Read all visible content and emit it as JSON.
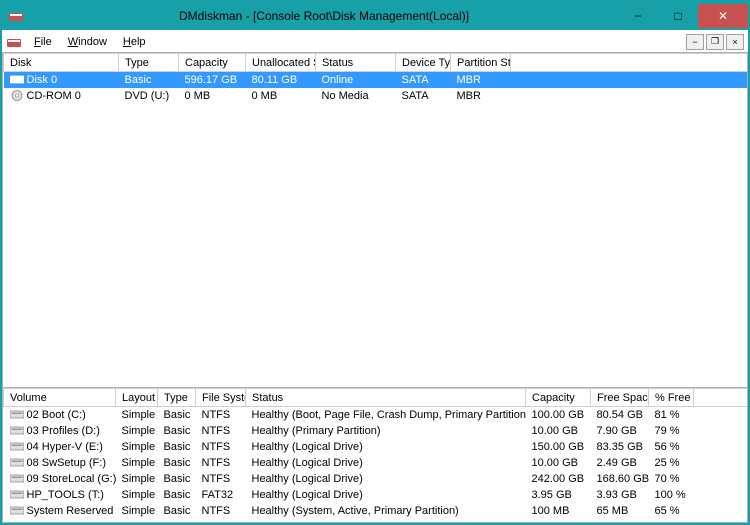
{
  "window": {
    "title": "DMdiskman - [Console Root\\Disk Management(Local)]"
  },
  "menu": {
    "file": "File",
    "window": "Window",
    "help": "Help"
  },
  "top_table": {
    "headers": {
      "disk": "Disk",
      "type": "Type",
      "capacity": "Capacity",
      "unallocated": "Unallocated Sp...",
      "status": "Status",
      "device_type": "Device Type",
      "partition_style": "Partition Style"
    },
    "rows": [
      {
        "disk": "Disk 0",
        "type": "Basic",
        "capacity": "596.17 GB",
        "unallocated": "80.11 GB",
        "status": "Online",
        "device_type": "SATA",
        "partition_style": "MBR",
        "selected": true,
        "icon": "hdd"
      },
      {
        "disk": "CD-ROM 0",
        "type": "DVD (U:)",
        "capacity": "0 MB",
        "unallocated": "0 MB",
        "status": "No Media",
        "device_type": "SATA",
        "partition_style": "MBR",
        "selected": false,
        "icon": "cd"
      }
    ]
  },
  "bottom_table": {
    "headers": {
      "volume": "Volume",
      "layout": "Layout",
      "type": "Type",
      "fs": "File System",
      "status": "Status",
      "capacity": "Capacity",
      "free": "Free Space",
      "pct": "% Free"
    },
    "rows": [
      {
        "volume": "02 Boot (C:)",
        "layout": "Simple",
        "type": "Basic",
        "fs": "NTFS",
        "status": "Healthy (Boot, Page File, Crash Dump, Primary Partition)",
        "capacity": "100.00 GB",
        "free": "80.54 GB",
        "pct": "81 %"
      },
      {
        "volume": "03 Profiles (D:)",
        "layout": "Simple",
        "type": "Basic",
        "fs": "NTFS",
        "status": "Healthy (Primary Partition)",
        "capacity": "10.00 GB",
        "free": "7.90 GB",
        "pct": "79 %"
      },
      {
        "volume": "04 Hyper-V (E:)",
        "layout": "Simple",
        "type": "Basic",
        "fs": "NTFS",
        "status": "Healthy (Logical Drive)",
        "capacity": "150.00 GB",
        "free": "83.35 GB",
        "pct": "56 %"
      },
      {
        "volume": "08 SwSetup (F:)",
        "layout": "Simple",
        "type": "Basic",
        "fs": "NTFS",
        "status": "Healthy (Logical Drive)",
        "capacity": "10.00 GB",
        "free": "2.49 GB",
        "pct": "25 %"
      },
      {
        "volume": "09 StoreLocal (G:)",
        "layout": "Simple",
        "type": "Basic",
        "fs": "NTFS",
        "status": "Healthy (Logical Drive)",
        "capacity": "242.00 GB",
        "free": "168.60 GB",
        "pct": "70 %"
      },
      {
        "volume": "HP_TOOLS (T:)",
        "layout": "Simple",
        "type": "Basic",
        "fs": "FAT32",
        "status": "Healthy (Logical Drive)",
        "capacity": "3.95 GB",
        "free": "3.93 GB",
        "pct": "100 %"
      },
      {
        "volume": "System Reserved",
        "layout": "Simple",
        "type": "Basic",
        "fs": "NTFS",
        "status": "Healthy (System, Active, Primary Partition)",
        "capacity": "100 MB",
        "free": "65 MB",
        "pct": "65 %"
      }
    ]
  }
}
